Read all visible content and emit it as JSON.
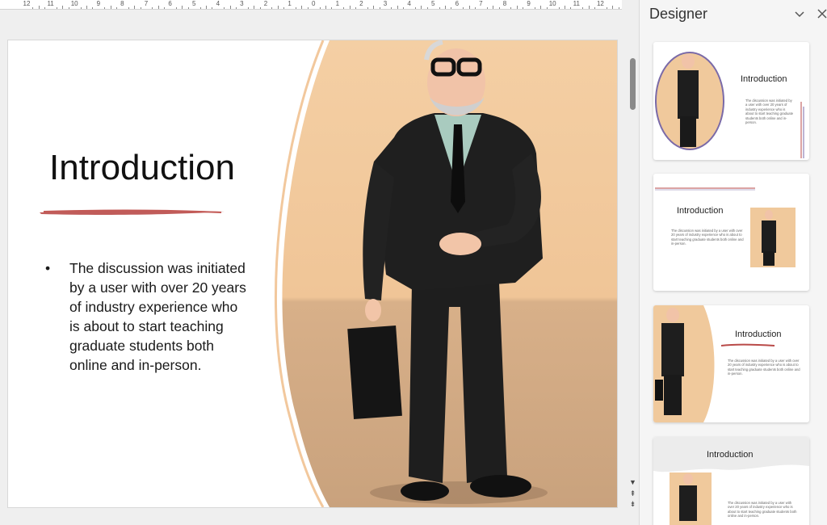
{
  "ruler": {
    "labels": [
      "12",
      "11",
      "10",
      "9",
      "8",
      "7",
      "6",
      "5",
      "4",
      "3",
      "2",
      "1",
      "0",
      "1",
      "2",
      "3",
      "4",
      "5",
      "6",
      "7",
      "8",
      "9",
      "10",
      "11",
      "12"
    ]
  },
  "slide": {
    "title": "Introduction",
    "bullet_symbol": "•",
    "bullet_text": "The discussion was initiated by a user with over 20 years of industry experience who is about to start teaching graduate students both online and in-person.",
    "accent_color": "#b94a48",
    "photo_bg": "#f2c99e"
  },
  "scrollbar": {
    "prev_slide_icon": "chevron-up",
    "next_slide_icon": "chevron-down"
  },
  "designer": {
    "title": "Designer",
    "collapse_icon": "chevron-down-icon",
    "close_icon": "close-icon",
    "cards": [
      {
        "title": "Introduction",
        "body": "The discussion was initiated by a user with over 20 years of industry experience who is about to start teaching graduate students both online and in-person."
      },
      {
        "title": "Introduction",
        "body": "The discussion was initiated by a user with over 20 years of industry experience who is about to start teaching graduate students both online and in-person."
      },
      {
        "title": "Introduction",
        "body": "The discussion was initiated by a user with over 20 years of industry experience who is about to start teaching graduate students both online and in-person."
      },
      {
        "title": "Introduction",
        "body": "The discussion was initiated by a user with over 20 years of industry experience who is about to start teaching graduate students both online and in-person."
      }
    ]
  }
}
